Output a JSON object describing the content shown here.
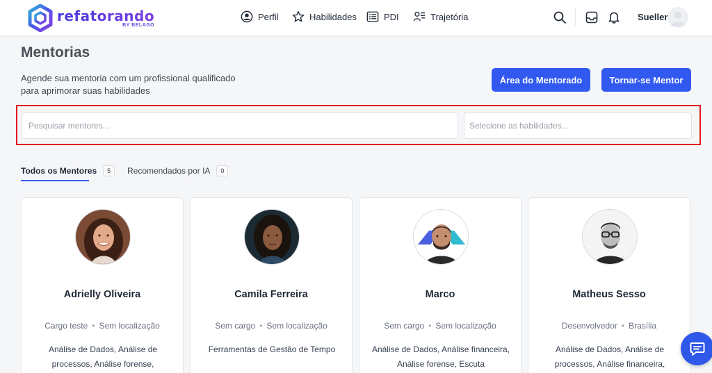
{
  "brand": {
    "name": "refatorando",
    "sub": "BY BELAGO"
  },
  "nav": [
    {
      "label": "Perfil",
      "icon": "user-circle-icon"
    },
    {
      "label": "Habilidades",
      "icon": "star-icon"
    },
    {
      "label": "PDI",
      "icon": "list-icon"
    },
    {
      "label": "Trajetória",
      "icon": "user-list-icon"
    }
  ],
  "header": {
    "user_name": "Suellen"
  },
  "page": {
    "title": "Mentorias",
    "subtitle": "Agende sua mentoria com um profissional qualificado para aprimorar suas habilidades",
    "btn_mentorado": "Área do Mentorado",
    "btn_mentor": "Tornar-se Mentor"
  },
  "search": {
    "mentor_placeholder": "Pesquisar mentores...",
    "skills_placeholder": "Selecione as habilidades..."
  },
  "tabs": [
    {
      "label": "Todos os Mentores",
      "count": "5"
    },
    {
      "label": "Recomendados por IA",
      "count": "0"
    }
  ],
  "mentors": [
    {
      "name": "Adrielly Oliveira",
      "role": "Cargo teste",
      "location": "Sem localização",
      "skills": "Análise de Dados, Análise de processos, Análise forense,"
    },
    {
      "name": "Camila Ferreira",
      "role": "Sem cargo",
      "location": "Sem localização",
      "skills": "Ferramentas de Gestão de Tempo"
    },
    {
      "name": "Marco",
      "role": "Sem cargo",
      "location": "Sem localização",
      "skills": "Análise de Dados, Análise financeira, Análise forense, Escuta"
    },
    {
      "name": "Matheus Sesso",
      "role": "Desenvolvedor",
      "location": "Brasília",
      "skills": "Análise de Dados, Análise de processos, Análise financeira,"
    }
  ],
  "colors": {
    "primary": "#3159f0",
    "highlight": "#e3161f"
  }
}
